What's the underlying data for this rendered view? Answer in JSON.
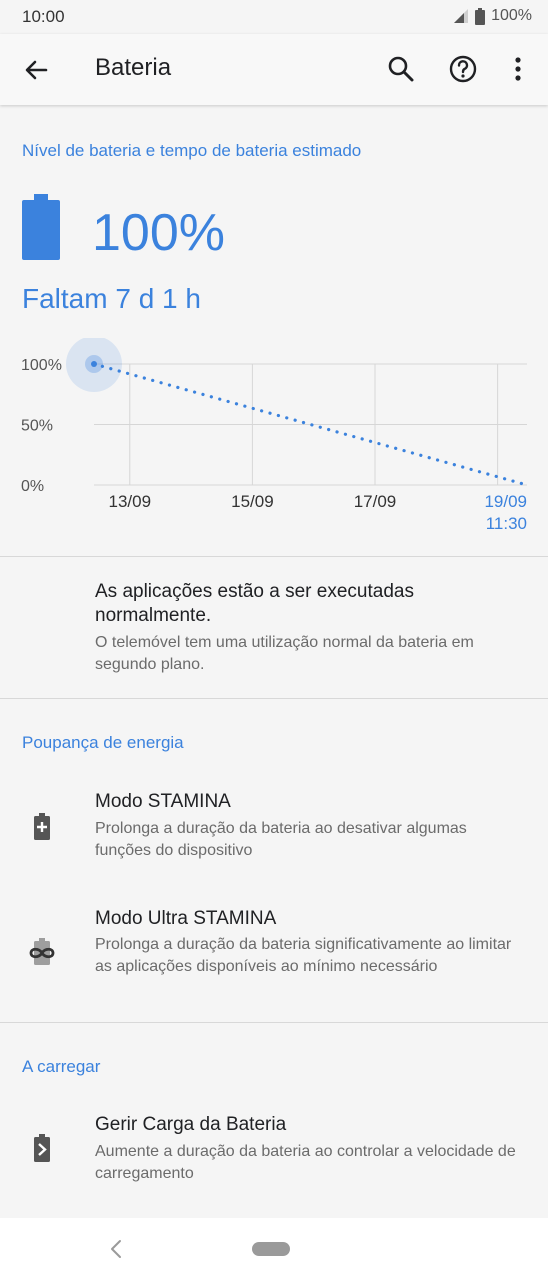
{
  "status": {
    "time": "10:00",
    "battery": "100%"
  },
  "appbar": {
    "title": "Bateria"
  },
  "battery": {
    "section_title": "Nível de bateria e tempo de bateria estimado",
    "percent": "100%",
    "remaining": "Faltam 7 d 1 h"
  },
  "chart_data": {
    "type": "line",
    "y_ticks": [
      "100%",
      "50%",
      "0%"
    ],
    "x_ticks": [
      "13/09",
      "15/09",
      "17/09",
      "19/09"
    ],
    "end_time": "11:30",
    "series": [
      {
        "x": [
          "12/09 10:00",
          "19/09 11:30"
        ],
        "y": [
          100,
          0
        ]
      }
    ],
    "ylim": [
      0,
      100
    ],
    "grid": true,
    "colors": {
      "line": "#3b82dd",
      "accent_label": "#3b82dd"
    }
  },
  "apps_status": {
    "title": "As aplicações estão a ser executadas normalmente.",
    "subtitle": "O telemóvel tem uma utilização normal da bateria em segundo plano."
  },
  "power_saving": {
    "section_title": "Poupança de energia",
    "items": [
      {
        "title": "Modo STAMINA",
        "subtitle": "Prolonga a duração da bateria ao desativar algumas funções do dispositivo",
        "icon": "battery-plus-icon"
      },
      {
        "title": "Modo Ultra STAMINA",
        "subtitle": "Prolonga a duração da bateria significativamente ao limitar as aplicações disponíveis ao mínimo necessário",
        "icon": "battery-infinity-icon"
      }
    ]
  },
  "charging": {
    "section_title": "A carregar",
    "items": [
      {
        "title": "Gerir Carga da Bateria",
        "subtitle": "Aumente a duração da bateria ao controlar a velocidade de carregamento",
        "icon": "battery-care-icon"
      }
    ]
  },
  "colors": {
    "accent": "#3b82dd",
    "background": "#f5f5f5"
  }
}
